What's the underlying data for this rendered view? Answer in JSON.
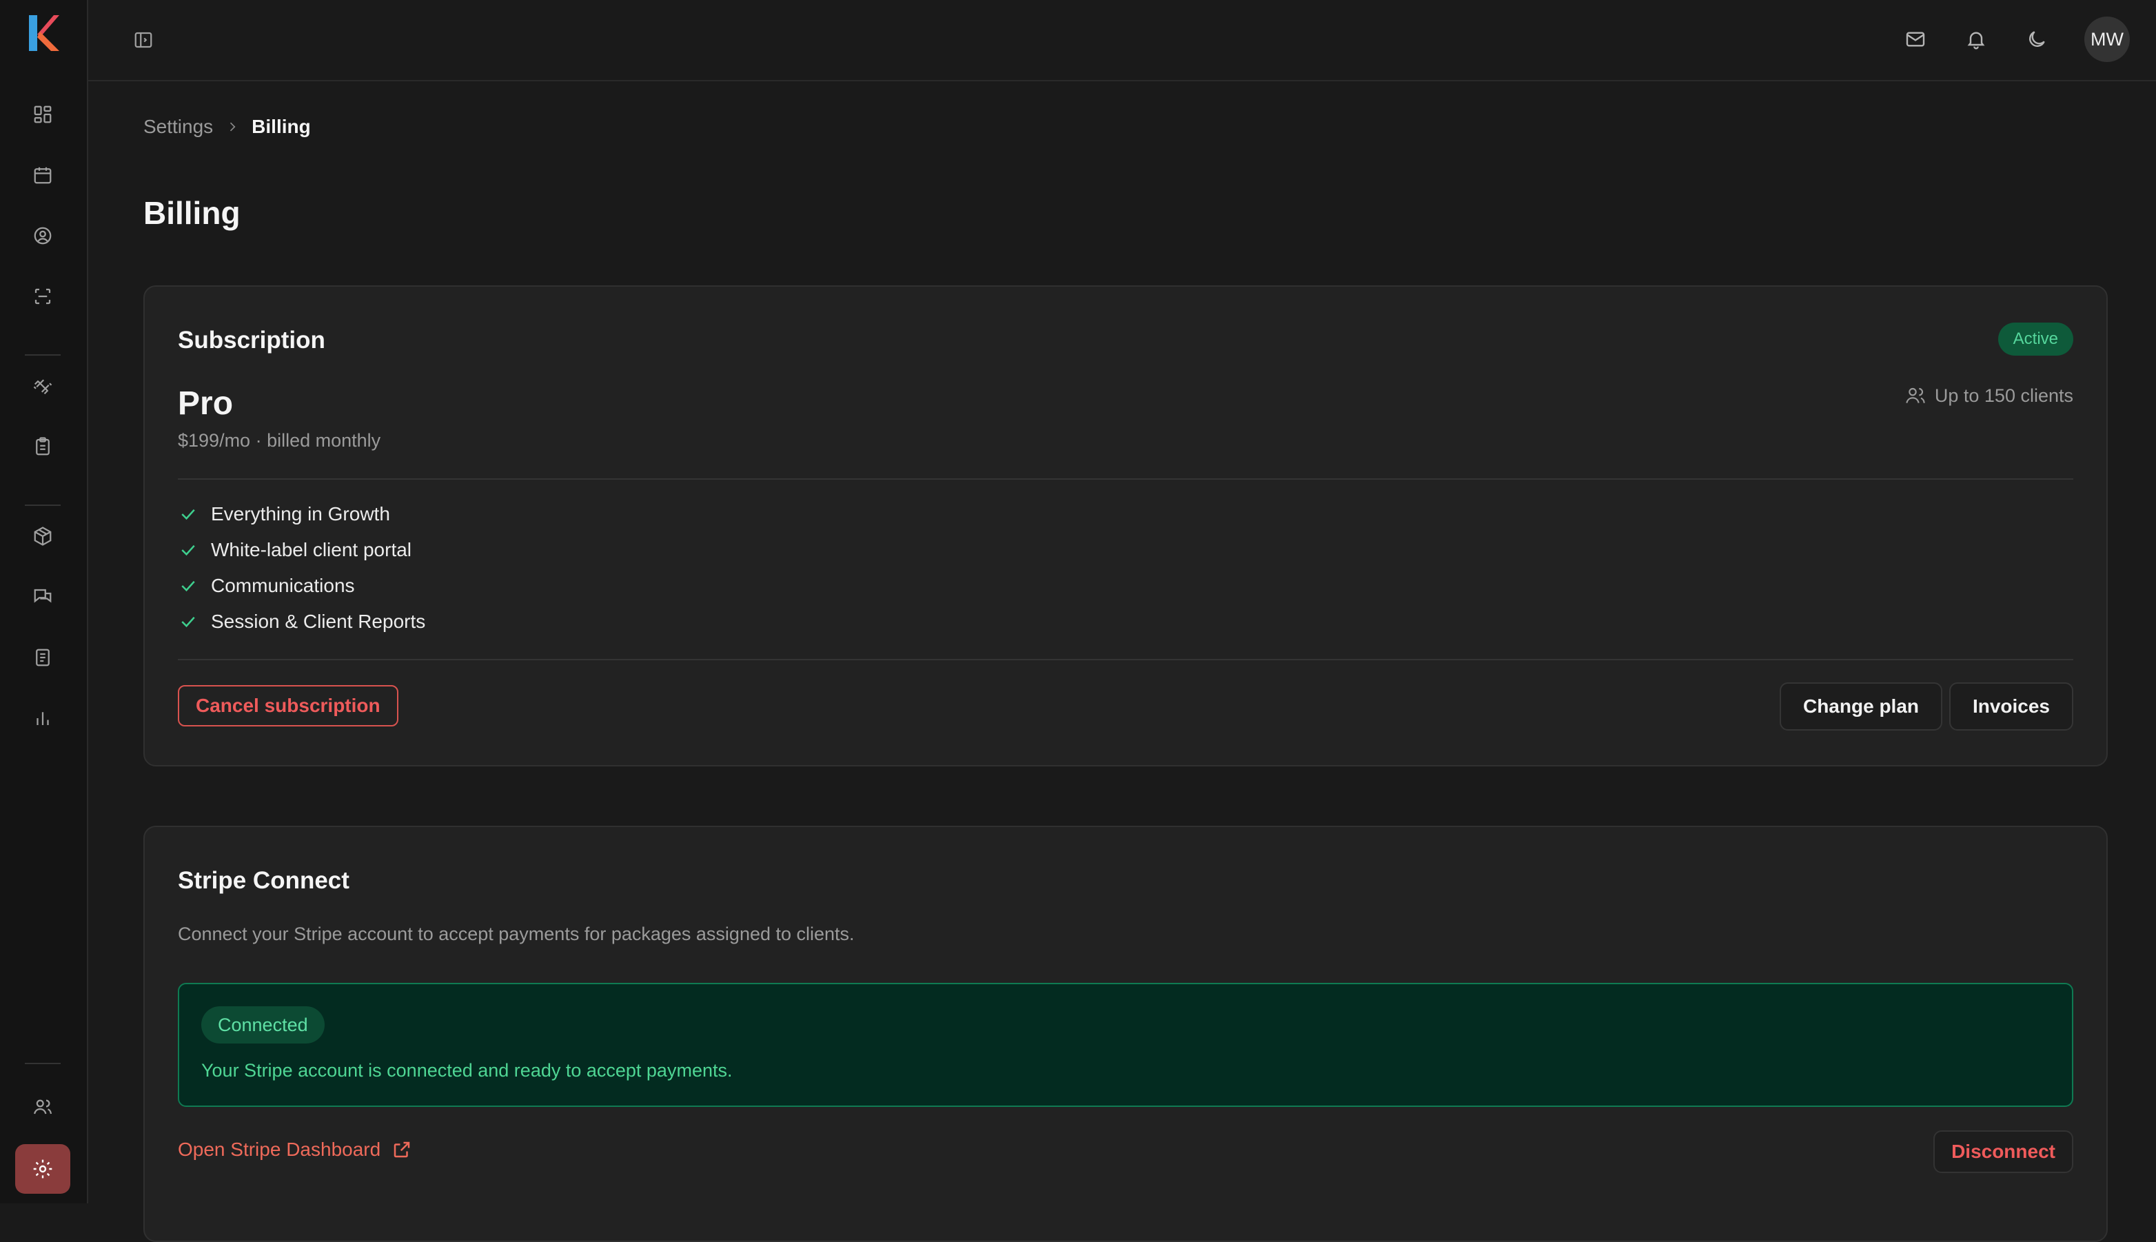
{
  "header": {
    "avatar_initials": "MW",
    "icons": [
      "sidebar-toggle-icon",
      "mail-icon",
      "bell-icon",
      "moon-icon"
    ]
  },
  "sidebar": {
    "items": [
      {
        "icon": "dashboard-icon"
      },
      {
        "icon": "calendar-icon"
      },
      {
        "icon": "user-circle-icon"
      },
      {
        "icon": "scan-icon"
      },
      {
        "icon": "dumbbell-icon"
      },
      {
        "icon": "clipboard-icon"
      },
      {
        "icon": "package-icon"
      },
      {
        "icon": "messages-icon"
      },
      {
        "icon": "document-icon"
      },
      {
        "icon": "bar-chart-icon"
      },
      {
        "icon": "users-icon"
      },
      {
        "icon": "settings-icon",
        "active": true
      }
    ]
  },
  "breadcrumb": {
    "parent": "Settings",
    "current": "Billing"
  },
  "page": {
    "title": "Billing"
  },
  "subscription": {
    "title": "Subscription",
    "status": "Active",
    "plan_name": "Pro",
    "price": "$199/mo · billed monthly",
    "limit": "Up to 150 clients",
    "features": [
      "Everything in Growth",
      "White-label client portal",
      "Communications",
      "Session & Client Reports"
    ],
    "cancel_label": "Cancel subscription",
    "change_plan_label": "Change plan",
    "invoices_label": "Invoices"
  },
  "stripe": {
    "title": "Stripe Connect",
    "description": "Connect your Stripe account to accept payments for packages assigned to clients.",
    "status_badge": "Connected",
    "status_message": "Your Stripe account is connected and ready to accept payments.",
    "dashboard_link": "Open Stripe Dashboard",
    "disconnect_label": "Disconnect"
  },
  "colors": {
    "background": "#1a1a1a",
    "card": "#222222",
    "accent_red": "#ef5b5b",
    "success_green": "#3ecf8e",
    "active_nav": "#8a3c3c"
  }
}
